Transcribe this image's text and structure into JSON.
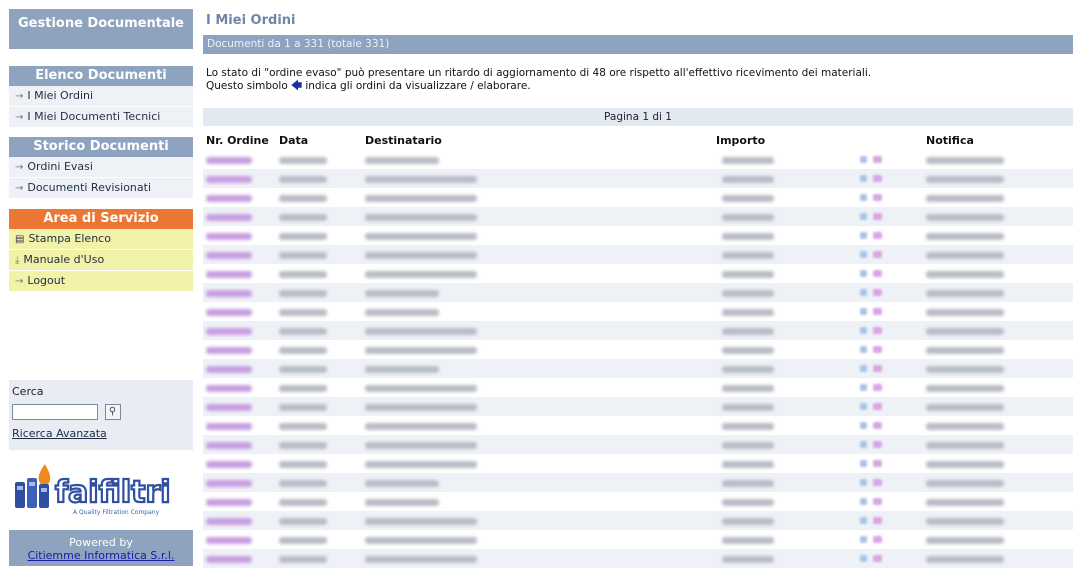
{
  "sidebar": {
    "app_title": "Gestione Documentale",
    "elenco": {
      "title": "Elenco Documenti",
      "items": [
        {
          "label": "I Miei Ordini"
        },
        {
          "label": "I Miei Documenti Tecnici"
        }
      ]
    },
    "storico": {
      "title": "Storico Documenti",
      "items": [
        {
          "label": "Ordini Evasi"
        },
        {
          "label": "Documenti Revisionati"
        }
      ]
    },
    "servizio": {
      "title": "Area di Servizio",
      "items": [
        {
          "label": "Stampa Elenco",
          "icon": "printer-icon"
        },
        {
          "label": "Manuale d'Uso",
          "icon": "download-icon"
        },
        {
          "label": "Logout",
          "icon": "arrow-right-icon"
        }
      ]
    },
    "search": {
      "label": "Cerca",
      "value": "",
      "advanced_label": "Ricerca Avanzata"
    },
    "logo": {
      "name": "faifiltri",
      "tagline": "A Quality Filtration Company"
    },
    "powered": {
      "label": "Powered by",
      "link": "Citiemme Informatica S.r.l."
    }
  },
  "main": {
    "title": "I Miei Ordini",
    "range": "Documenti da 1 a 331 (totale 331)",
    "note_line1": "Lo stato di \"ordine evaso\" può presentare un ritardo di aggiornamento di 48 ore rispetto all'effettivo ricevimento dei materiali.",
    "note_line2a": "Questo simbolo",
    "note_line2b": "indica gli ordini da visualizzare / elaborare.",
    "pager": "Pagina 1 di 1",
    "columns": {
      "nr_ordine": "Nr. Ordine",
      "data": "Data",
      "destinatario": "Destinatario",
      "importo": "Importo",
      "notifica": "Notifica"
    },
    "row_count": 22
  },
  "colors": {
    "header_blue": "#8ea3bf",
    "service_orange": "#ec7734",
    "service_yellow": "#f2f3a8",
    "row_alt": "#eef2f7"
  }
}
